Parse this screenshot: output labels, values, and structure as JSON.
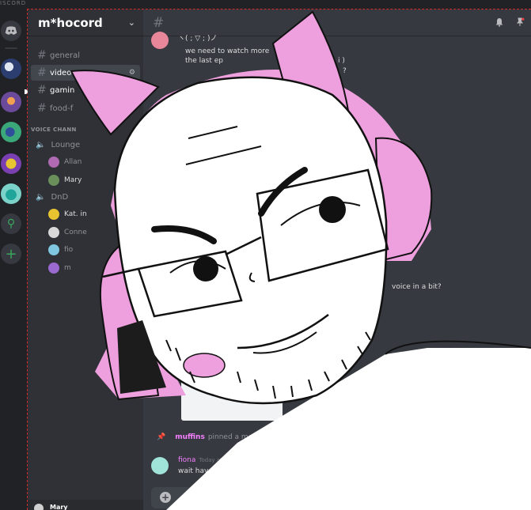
{
  "app_label": "ISCORD",
  "server_icons": [
    "discord-home-icon",
    "server-sailboat",
    "server-cat",
    "server-green",
    "server-purple",
    "server-teal",
    "explore-icon",
    "add-server-icon"
  ],
  "guild": {
    "name": "m*hocord"
  },
  "channels": [
    {
      "name": "general"
    },
    {
      "name": "videos"
    },
    {
      "name": "gamin"
    },
    {
      "name": "food-f"
    }
  ],
  "voice_category": "VOICE CHANN",
  "voice_channels": [
    {
      "name": "Lounge",
      "users": [
        {
          "name": "Allan"
        },
        {
          "name": "Mary"
        }
      ]
    },
    {
      "name": "DnD",
      "users": [
        {
          "name": "Kat. in"
        },
        {
          "name": "Conne"
        },
        {
          "name": "fio"
        },
        {
          "name": "m"
        }
      ]
    }
  ],
  "user_panel": {
    "name": "Mary"
  },
  "chat": {
    "messages": [
      {
        "line1": "ヽ( ; ▽ ; )ノ",
        "line2": "we need to watch more",
        "line3": "the last ep",
        "extra": "i )",
        "extra2": "?"
      },
      {
        "fragment": "voice in a bit?"
      }
    ],
    "pinned": {
      "user": "muffins",
      "text": "pinned a mess"
    },
    "last_message": {
      "user": "fiona",
      "time": "Today at 8",
      "text": "wait have"
    }
  },
  "colors": {
    "accent_pink": "#f47fff",
    "sidebar": "#2f3136",
    "chat_bg": "#36393f",
    "drawing_pink": "#ee9fdd"
  }
}
